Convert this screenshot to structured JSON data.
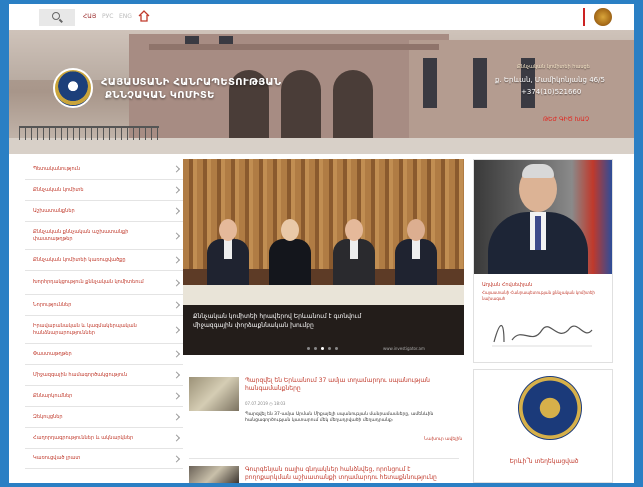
{
  "topbar": {
    "languages": [
      "ՀԱՅ",
      "РУС",
      "ENG"
    ]
  },
  "header": {
    "org_name_line1": "ՀԱՅԱՍՏԱՆԻ ՀԱՆՐԱՊԵՏՈՒԹՅԱՆ",
    "org_name_line2": "ՔՆՆՉԱԿԱՆ ԿՈՄԻՏԵ",
    "hotline": "Քննչական կոմիտեի հասցե",
    "address": "ք. Երևան, Մամիկոնյանց 46/5",
    "phone": "+374(10)521660",
    "feedback_link": "ԹԵԺ ԳԻԾ ԽԱՉ"
  },
  "sidebar": {
    "items": [
      "Պետականություն",
      "Քննչական կոմիտե",
      "Աշխատանքներ",
      "Քննչական քննչական աշխատանքի փաստաթղթեր",
      "Քննչական կոմիտեի կառուցվածքը",
      "Խորհրդակցություն քննչական կոմիտեում",
      "Նորություններ",
      "Իրավաբանական և կազմակերպական հանձնարարություններ",
      "Փաստաթղթեր",
      "Միջազգային համագործակցություն",
      "Քննարկումներ",
      "Զեկույցներ",
      "Հաղորդագրություններ և ակնարկներ",
      "Կառուցված լրատ"
    ]
  },
  "slider": {
    "caption": "Քննչական կոմիտեի հրավերով Երևանում է գտնվում միջազգային փորձաքննական խումբը",
    "source": "www.investigator.am",
    "dots": 5,
    "active_dot": 2
  },
  "news": [
    {
      "title": "Պարզվել են Երևանում 37 ամյա տղամարդու սպանության հանգամանքները",
      "meta": "07.07.2019  ◷ 18:03",
      "body": "Պարզվել են 37-ամյա Արման Միքայելի սպանության մանրամասները, ամենևին հանցագործության կատարում մեկ մեղադրվածի մեղադրանք։",
      "more": "Նախուր ավելին"
    },
    {
      "title": "Գուրգենյան ռալիս գնդակներ հանձնվեց, որոնցում է բողոքարկման աշխատանքի տղամարդու հետաքննությունը"
    }
  ],
  "right_panel": {
    "chair_name": "Աղվան Հովսեփյան",
    "chair_role": "Հայաստանի Հանրապետության քննչական կոմիտեի նախագահ",
    "signature": "Ա. Հովսեփյան",
    "hotline_label": "Երևի՞ն տեղեկացված"
  },
  "colors": {
    "outer_border": "#2a7fc4",
    "link_red": "#c0392b",
    "caption_bg": "#191919"
  }
}
